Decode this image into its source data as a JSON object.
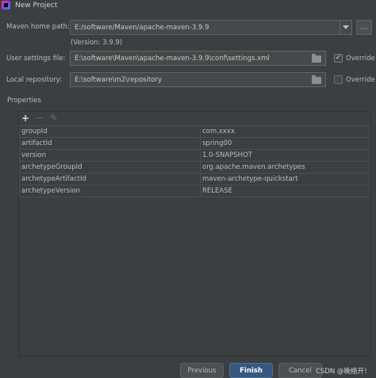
{
  "window": {
    "title": "New Project"
  },
  "maven_home": {
    "label": "Maven home path:",
    "value": "E:/software/Maven/apache-maven-3.9.9",
    "ellipsis": "...",
    "version_note": "(Version: 3.9.9)"
  },
  "user_settings": {
    "label": "User settings file:",
    "value": "E:\\software\\Maven\\apache-maven-3.9.9\\conf\\settings.xml",
    "override_label": "Override",
    "override_checked": true
  },
  "local_repo": {
    "label": "Local repository:",
    "value": "E:\\software\\m2\\repository",
    "override_label": "Override",
    "override_checked": false
  },
  "properties": {
    "title": "Properties",
    "toolbar": {
      "add": "+",
      "remove": "−",
      "edit": "✎"
    },
    "rows": [
      {
        "key": "groupId",
        "value": "com.xxxx"
      },
      {
        "key": "artifactId",
        "value": "spring00"
      },
      {
        "key": "version",
        "value": "1.0-SNAPSHOT"
      },
      {
        "key": "archetypeGroupId",
        "value": "org.apache.maven.archetypes"
      },
      {
        "key": "archetypeArtifactId",
        "value": "maven-archetype-quickstart"
      },
      {
        "key": "archetypeVersion",
        "value": "RELEASE"
      }
    ]
  },
  "footer": {
    "previous": "Previous",
    "finish": "Finish",
    "cancel": "Cancel",
    "watermark": "CSDN @晚络开！"
  },
  "colors": {
    "background": "#3c3f41",
    "primary_button": "#365880"
  }
}
